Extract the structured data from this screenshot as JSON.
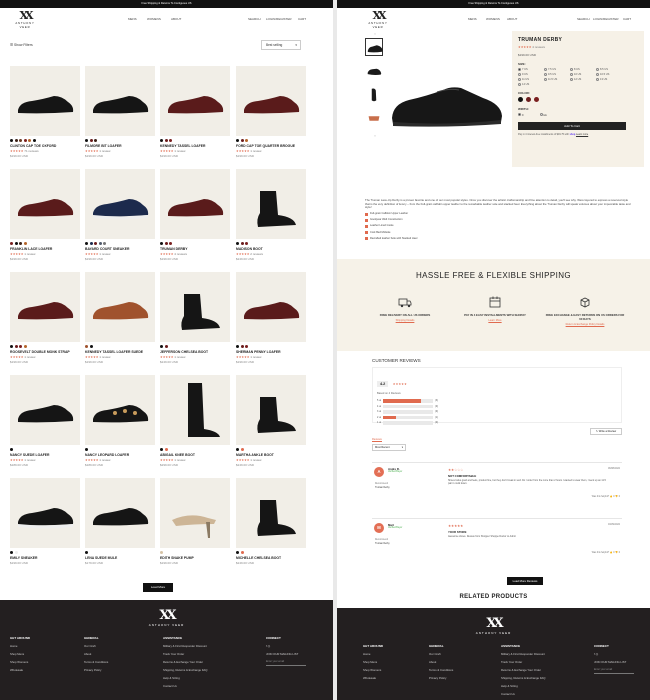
{
  "announcement": "Free Shipping & Returns To Contiguous US",
  "brand": {
    "mark": "XX",
    "word": "ANTHONY VEER"
  },
  "nav": {
    "left": [
      "MENS",
      "WOMENS",
      "ABOUT"
    ],
    "right": [
      "SEARCH",
      "LOGIN/REGISTER",
      "CART"
    ]
  },
  "listing": {
    "show_filters": "Show Filters",
    "sort": "Best selling",
    "load_more": "Load More",
    "products": [
      {
        "name": "CLINTON CAP TOE OXFORD",
        "stars": "★★★★★",
        "reviews": "71 reviews",
        "price": "$199.00 USD",
        "shoe": "oxford-black",
        "swatches": [
          "#111",
          "#3b2016",
          "#6b3a22",
          "#7a1f1f",
          "#b5652a",
          "#111"
        ]
      },
      {
        "name": "FILMORE BIT LOAFER",
        "stars": "★★★★★",
        "reviews": "1 review",
        "price": "$199.00 USD",
        "shoe": "loafer-black",
        "swatches": [
          "#111",
          "#6b1c1c",
          "#3b2016"
        ]
      },
      {
        "name": "KENNEDY TASSEL LOAFER",
        "stars": "★★★★★",
        "reviews": "1 review",
        "price": "$199.00 USD",
        "shoe": "tassel-burgundy",
        "swatches": [
          "#111",
          "#6b1c1c",
          "#7a1f1f"
        ]
      },
      {
        "name": "FORD CAP TOE QUARTER BROGUE",
        "stars": "★★★★★",
        "reviews": "1 review",
        "price": "$199.00 USD",
        "shoe": "brogue-burgundy",
        "swatches": [
          "#111",
          "#6b1c1c",
          "#b5652a"
        ]
      },
      {
        "name": "FRANKLIN LACE LOAFER",
        "stars": "★★★★★",
        "reviews": "1 review",
        "price": "$199.00 USD",
        "shoe": "loafer-burgundy",
        "swatches": [
          "#7a1f1f",
          "#111",
          "#3b2016",
          "#b5652a"
        ]
      },
      {
        "name": "BAYARD COURT SNEAKER",
        "stars": "★★★★★",
        "reviews": "1 review",
        "price": "$199.00 USD",
        "shoe": "sneaker-navy",
        "swatches": [
          "#111",
          "#1c2a4d",
          "#6b1c1c",
          "#4f5a6b",
          "#777"
        ]
      },
      {
        "name": "TRUMAN DERBY",
        "stars": "★★★★★",
        "reviews": "4 reviews",
        "price": "$199.00 USD",
        "shoe": "derby-burgundy",
        "swatches": [
          "#111",
          "#6b1c1c",
          "#7a1f1f"
        ]
      },
      {
        "name": "MADISON BOOT",
        "stars": "★★★★★",
        "reviews": "2 reviews",
        "price": "$249.00 USD",
        "shoe": "boot-black",
        "swatches": [
          "#111",
          "#6b1c1c",
          "#7a1f1f"
        ]
      },
      {
        "name": "ROOSEVELT DOUBLE MONK STRAP",
        "stars": "★★★★★",
        "reviews": "1 review",
        "price": "$199.00 USD",
        "shoe": "monk-burgundy",
        "swatches": [
          "#111",
          "#6b1c1c",
          "#7a1f1f",
          "#b5652a"
        ]
      },
      {
        "name": "KENNEDY TASSEL LOAFER SUEDE",
        "stars": "★★★★★",
        "reviews": "1 review",
        "price": "$199.00 USD",
        "shoe": "tassel-tan",
        "swatches": [
          "#a0522d",
          "#111"
        ]
      },
      {
        "name": "JEFFERSON CHELSEA BOOT",
        "stars": "★★★★★",
        "reviews": "1 review",
        "price": "$249.00 USD",
        "shoe": "chelsea-black",
        "swatches": [
          "#111",
          "#6b1c1c"
        ]
      },
      {
        "name": "SHERMAN PENNY LOAFER",
        "stars": "★★★★★",
        "reviews": "1 review",
        "price": "$199.00 USD",
        "shoe": "penny-burgundy",
        "swatches": [
          "#111",
          "#6b1c1c",
          "#7a1f1f"
        ]
      },
      {
        "name": "NANCY SUEDE LOAFER",
        "stars": "★★★★★",
        "reviews": "1 review",
        "price": "$189.00 USD",
        "shoe": "flat-black",
        "swatches": [
          "#111"
        ]
      },
      {
        "name": "NANCY LEOPARD LOAFER",
        "stars": "★★★★★",
        "reviews": "1 review",
        "price": "$189.00 USD",
        "shoe": "flat-leopard",
        "swatches": [
          "#111"
        ]
      },
      {
        "name": "ABIGAIL KNEE BOOT",
        "stars": "★★★★★",
        "reviews": "1 review",
        "price": "$299.00 USD",
        "shoe": "tallboot-black",
        "swatches": [
          "#111",
          "#e06a4e"
        ]
      },
      {
        "name": "MARTHA ANKLE BOOT",
        "stars": "★★★★★",
        "reviews": "1 review",
        "price": "$249.00 USD",
        "shoe": "ankleboot-black",
        "swatches": [
          "#111",
          "#e06a4e"
        ]
      },
      {
        "name": "EMILY SNEAKER",
        "stars": "",
        "reviews": "",
        "price": "$199.00 USD",
        "shoe": "sneaker-black",
        "swatches": [
          "#111",
          "#eee"
        ]
      },
      {
        "name": "LENA SUEDE MULE",
        "stars": "",
        "reviews": "",
        "price": "$179.00 USD",
        "shoe": "mule-black",
        "swatches": [
          "#111"
        ]
      },
      {
        "name": "EDITH SNAKE PUMP",
        "stars": "",
        "reviews": "",
        "price": "$199.00 USD",
        "shoe": "pump-snake",
        "swatches": [
          "#d6c3a5"
        ]
      },
      {
        "name": "MICHELLE CHELSEA BOOT",
        "stars": "",
        "reviews": "",
        "price": "$249.00 USD",
        "shoe": "chelsea-womens",
        "swatches": [
          "#111",
          "#e06a4e"
        ]
      }
    ]
  },
  "footer": {
    "columns": [
      {
        "title": "GET AROUND",
        "links": [
          "Home",
          "Shop Mens",
          "Shop Womens",
          "Wholesale"
        ]
      },
      {
        "title": "GENERAL",
        "links": [
          "Our Craft",
          "About",
          "Terms & Conditions",
          "Privacy Policy"
        ]
      },
      {
        "title": "ASSISTANCE",
        "links": [
          "Military & First Responder Discount",
          "Track Your Order",
          "Returns & Exchange Your Order",
          "Shipping, Returns & Exchange FAQ",
          "Help & Sizing",
          "Contact Us"
        ]
      },
      {
        "title": "CONNECT",
        "links": []
      }
    ],
    "social": [
      "f",
      "◎"
    ],
    "signup": "JOIN OUR MAILING LIST",
    "email_placeholder": "Enter your email"
  },
  "product": {
    "title": "TRUMAN DERBY",
    "stars": "★★★★★",
    "reviews": "4 reviews",
    "price": "$199.00 USD",
    "size_label": "SIZE:",
    "sizes": [
      "7 US",
      "7.5 US",
      "8 US",
      "8.5 US",
      "9 US",
      "9.5 US",
      "10 US",
      "10.5 US",
      "11 US",
      "11.5 US",
      "12 US",
      "13 US",
      "14 US"
    ],
    "color_label": "COLOR:",
    "colors": [
      "#111",
      "#6b1c1c",
      "#7a1f1f"
    ],
    "width_label": "WIDTH:",
    "widths": [
      "D",
      "EE"
    ],
    "add_to_cart": "Add To Cart",
    "paynote": "Pay in 4 interest-free installments of $49.75 with",
    "paybrand": "shop",
    "learn": "Learn more",
    "description": "The Truman Lace-Up Derby is a proven favorite and one of our most popular styles. Once you discover the artistic craftsmanship and fine attention to detail, you'll see why. Were layered to express a reserved style that is the very definition of luxury – from the Full-grain calfskin upper leather to the remarkable leather sole and stacked heel. Everything about the Truman Derby will speak volumes about your impeccable taste and style!",
    "features": [
      "Full-grain Calfskin Upper Leather",
      "Goodyear Welt Construction",
      "Leather Lined Insole",
      "Cork Bed Midsole",
      "Recrafted leather Sole with Stacked Heel"
    ]
  },
  "shipping": {
    "title": "HASSLE FREE & FLEXIBLE SHIPPING",
    "items": [
      {
        "text": "FREE DELIVERY ON ALL US ORDERS",
        "link": "Shipping Details"
      },
      {
        "text": "PAY IN 4 EASY INSTALLMENTS WITH SHOPAY",
        "link": "Learn More"
      },
      {
        "text": "FREE EXCHANGE & EASY RETURNS ON US ORDERS FOR 60 DAYS",
        "link": "Return & Exchange Policy Details"
      }
    ]
  },
  "customer_reviews": {
    "heading": "CUSTOMER REVIEWS",
    "average": "4.2",
    "stars": "★★★★★",
    "based": "Based on 4 Reviews",
    "bars": [
      {
        "label": "5 ★",
        "pct": 0.75,
        "count": "(3)"
      },
      {
        "label": "4 ★",
        "pct": 0.0,
        "count": "(0)"
      },
      {
        "label": "3 ★",
        "pct": 0.0,
        "count": "(0)"
      },
      {
        "label": "2 ★",
        "pct": 0.25,
        "count": "(1)"
      },
      {
        "label": "1 ★",
        "pct": 0.0,
        "count": "(0)"
      }
    ],
    "write": "Write a Review",
    "tab": "Reviews",
    "select": "Most Recent",
    "load_more": "Load More Reviews",
    "items": [
      {
        "initial": "A",
        "name": "Andre R.",
        "verified": "Verified Buyer",
        "date": "06/08/2022",
        "stars": "★★☆☆☆",
        "title": "NOT COMFORTABLE",
        "body": "Shoes looks good and feels, product fine, but they don't break in well. Do I order from the more than 2 hours I wanted to wear them, I went up an 11.5 pair it could down.",
        "meta1": "Recommend",
        "meta2": "Truman Derby"
      },
      {
        "initial": "M",
        "name": "Mart",
        "verified": "Verified Buyer",
        "date": "03/29/2022",
        "stars": "★★★★★",
        "title": "YOUR STORE",
        "body": "Awesome shoes. Review from Shopper Shoppe Doctor to Admit",
        "meta1": "Recommend",
        "meta2": "Truman Derby"
      }
    ]
  },
  "related": "RELATED PRODUCTS"
}
